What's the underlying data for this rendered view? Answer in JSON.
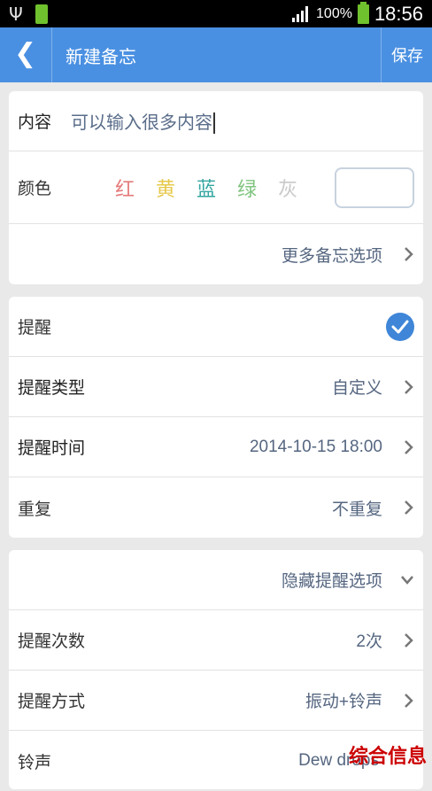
{
  "status_bar": {
    "battery_percent": "100%",
    "time": "18:56"
  },
  "app_bar": {
    "back_label": "❮",
    "title": "新建备忘",
    "save_label": "保存"
  },
  "note_card": {
    "content_label": "内容",
    "content_value": "可以输入很多内容",
    "color_label": "颜色",
    "colors": [
      {
        "label": "红",
        "color": "#e57a7a"
      },
      {
        "label": "黄",
        "color": "#e6c84a"
      },
      {
        "label": "蓝",
        "color": "#34a6a0"
      },
      {
        "label": "绿",
        "color": "#7fc47f"
      },
      {
        "label": "灰",
        "color": "#c9c9c9"
      }
    ],
    "more_options_label": "更多备忘选项"
  },
  "reminder_card": {
    "reminder_label": "提醒",
    "reminder_enabled": true,
    "type_label": "提醒类型",
    "type_value": "自定义",
    "time_label": "提醒时间",
    "time_value": "2014-10-15 18:00",
    "repeat_label": "重复",
    "repeat_value": "不重复"
  },
  "options_card": {
    "hide_options_label": "隐藏提醒选项",
    "count_label": "提醒次数",
    "count_value": "2次",
    "method_label": "提醒方式",
    "method_value": "振动+铃声",
    "ringtone_label": "铃声",
    "ringtone_value": "Dew drops"
  },
  "watermark": "综合信息",
  "icons": {
    "usb": "usb-icon",
    "battery": "battery-icon",
    "signal": "signal-icon",
    "chevron_right": "chevron-right-icon",
    "chevron_down": "chevron-down-icon",
    "check": "check-circle-icon"
  }
}
